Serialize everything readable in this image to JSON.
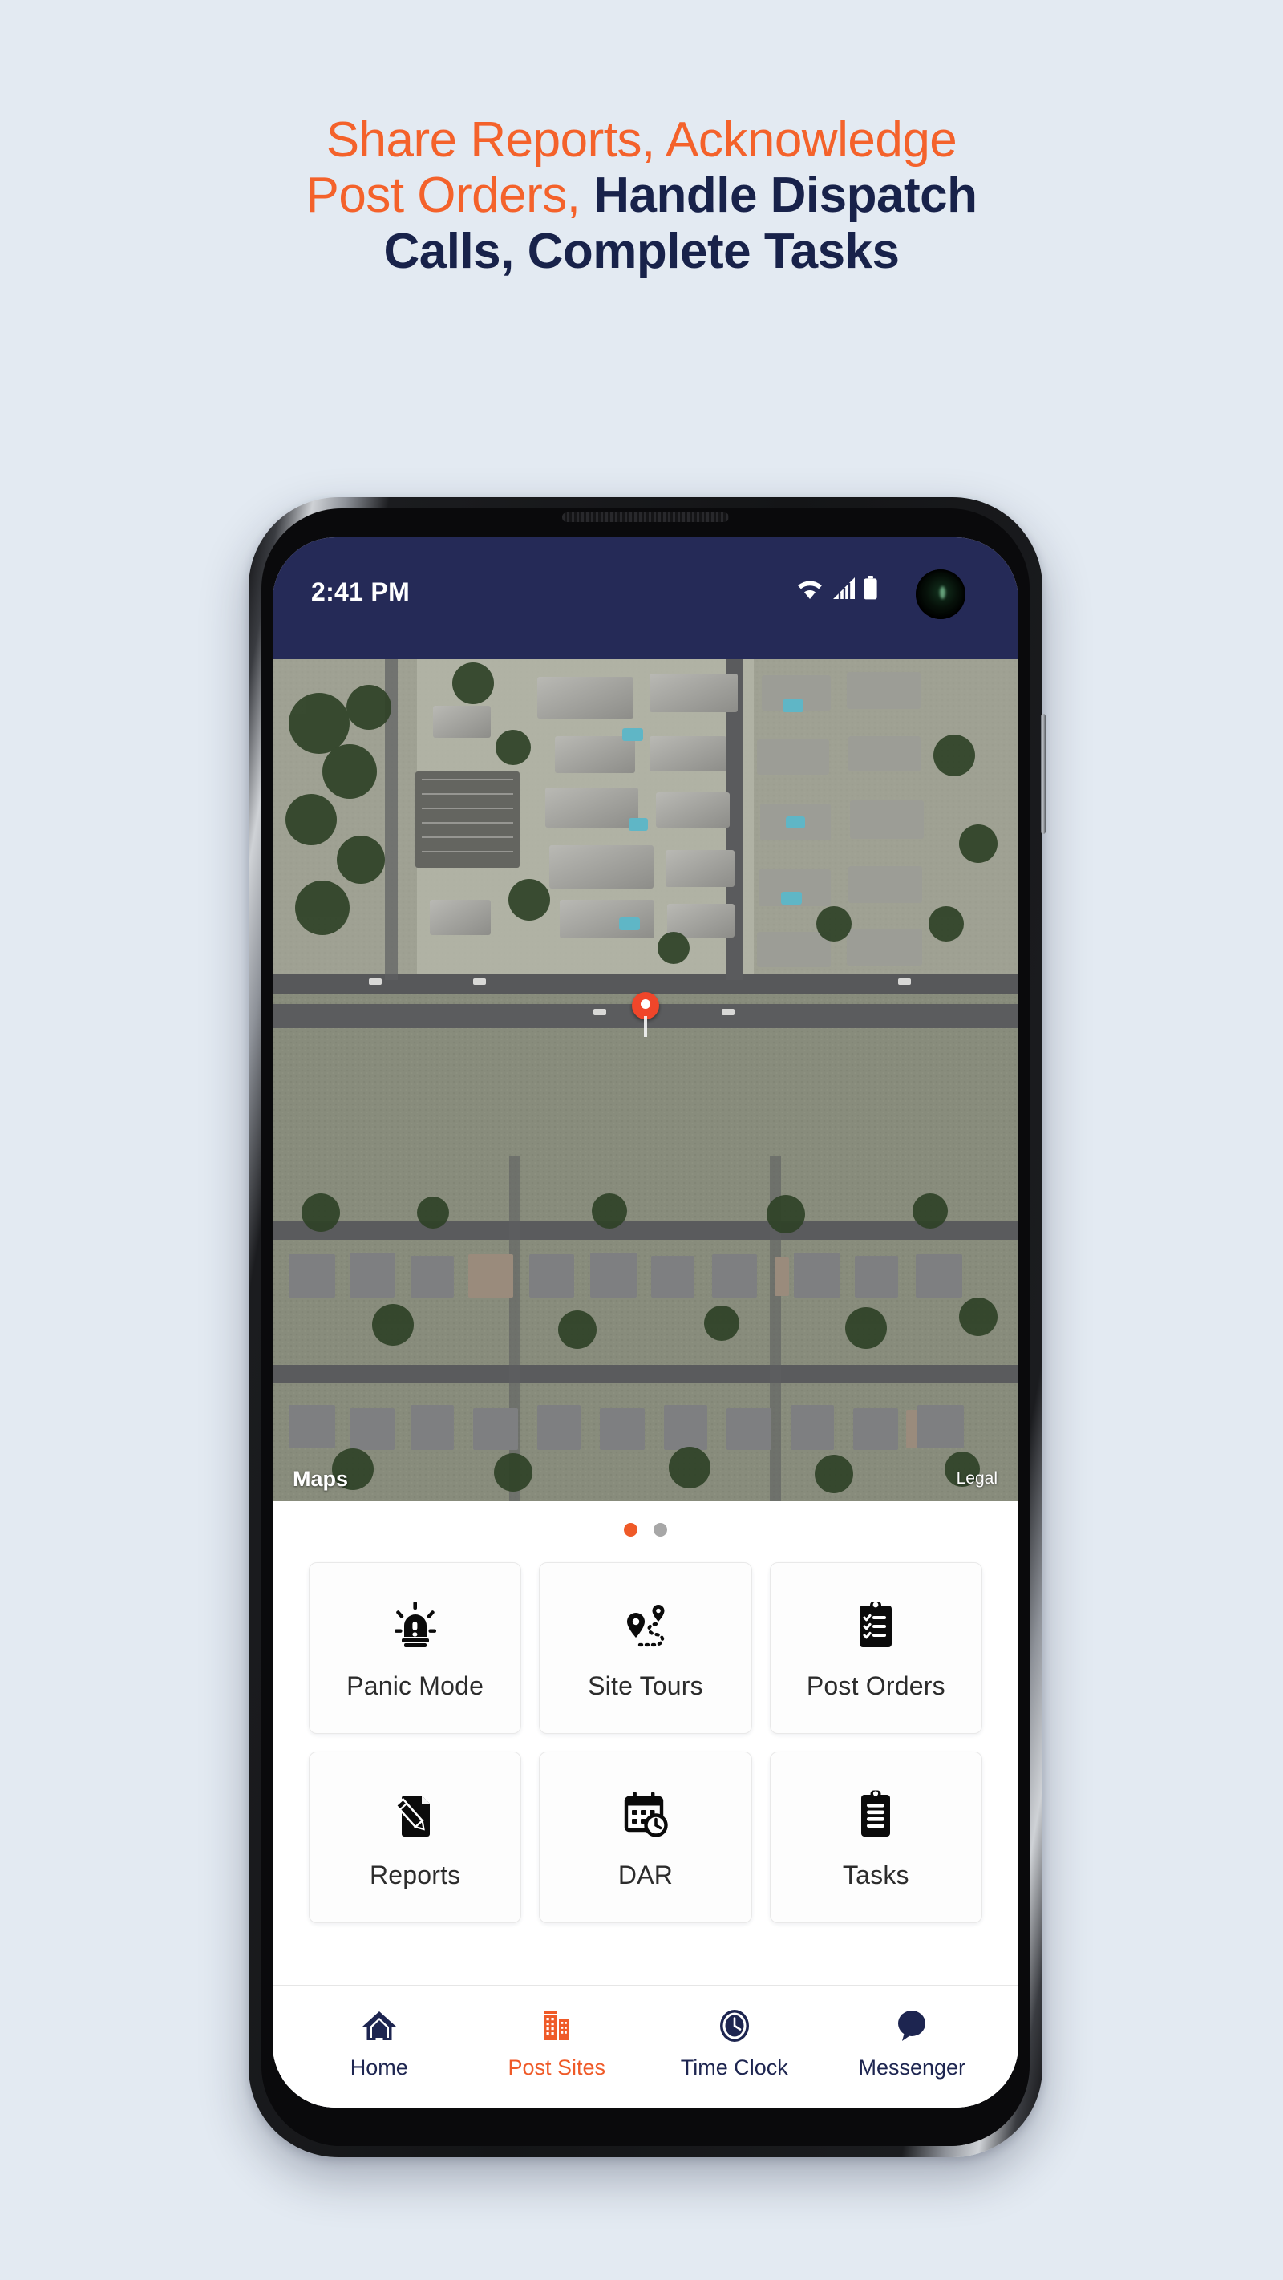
{
  "page": {
    "background_color": "#e3eaf2",
    "headline": {
      "line1": "Share Reports, Acknowledge",
      "line2_orange": "Post Orders,",
      "line2_navy": " Handle Dispatch",
      "line3": "Calls, Complete Tasks",
      "orange_color": "#f4622b",
      "navy_color": "#18224a"
    }
  },
  "phone": {
    "status_bar": {
      "time": "2:41 PM",
      "background_color": "#252a57",
      "icons": [
        "wifi-icon",
        "cellular-signal-icon",
        "battery-icon"
      ],
      "camera": "front-camera-punchhole"
    },
    "map": {
      "type": "satellite",
      "attribution_brand": "Maps",
      "attribution_glyph": "",
      "legal_link": "Legal",
      "marker": "location-pin-marker"
    },
    "carousel": {
      "page_count": 2,
      "active_index": 0,
      "active_color": "#ef5a28",
      "inactive_color": "#a7a7a7"
    },
    "shortcuts": [
      {
        "label": "Panic Mode",
        "icon": "siren-alarm-icon"
      },
      {
        "label": "Site Tours",
        "icon": "route-map-pins-icon"
      },
      {
        "label": "Post Orders",
        "icon": "clipboard-checklist-icon"
      },
      {
        "label": "Reports",
        "icon": "document-pencil-icon"
      },
      {
        "label": "DAR",
        "icon": "calendar-clock-icon"
      },
      {
        "label": "Tasks",
        "icon": "clipboard-lines-icon"
      }
    ],
    "bottom_nav": [
      {
        "label": "Home",
        "icon": "home-icon",
        "active": false
      },
      {
        "label": "Post Sites",
        "icon": "building-icon",
        "active": true
      },
      {
        "label": "Time Clock",
        "icon": "clock-icon",
        "active": false
      },
      {
        "label": "Messenger",
        "icon": "chat-bubble-icon",
        "active": false
      }
    ]
  }
}
